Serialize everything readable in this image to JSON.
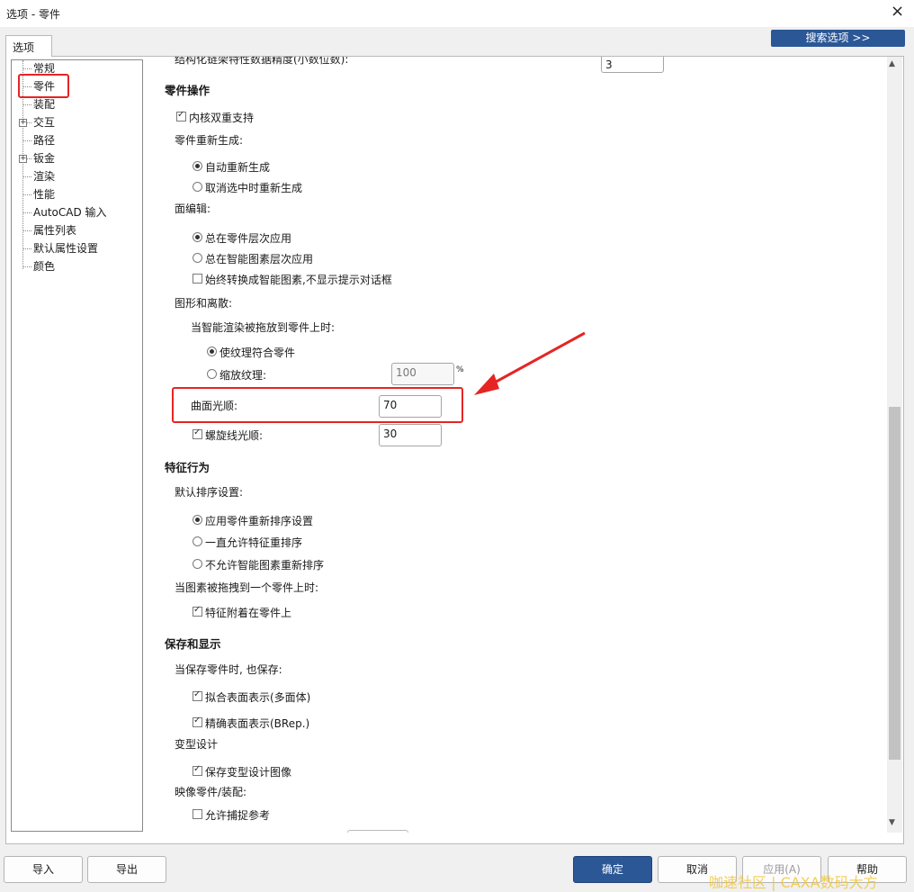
{
  "window": {
    "title": "选项 - 零件",
    "close": "×"
  },
  "tab": {
    "label": "选项"
  },
  "search_button": "搜索选项 >>",
  "tree": [
    {
      "label": "常规",
      "expandable": false
    },
    {
      "label": "零件",
      "expandable": false
    },
    {
      "label": "装配",
      "expandable": false
    },
    {
      "label": "交互",
      "expandable": true
    },
    {
      "label": "路径",
      "expandable": false
    },
    {
      "label": "钣金",
      "expandable": true
    },
    {
      "label": "渲染",
      "expandable": false
    },
    {
      "label": "性能",
      "expandable": false
    },
    {
      "label": "AutoCAD 输入",
      "expandable": false
    },
    {
      "label": "属性列表",
      "expandable": false
    },
    {
      "label": "默认属性设置",
      "expandable": false
    },
    {
      "label": "颜色",
      "expandable": false
    }
  ],
  "content": {
    "top_partial_label": "结构化链架特性数据精度(小数位数):",
    "top_partial_value": "3",
    "part_ops": {
      "heading": "零件操作",
      "dual_kernel": "内核双重支持",
      "regen_label": "零件重新生成:",
      "regen_auto": "自动重新生成",
      "regen_deselect": "取消选中时重新生成",
      "face_edit_label": "面编辑:",
      "face_part_level": "总在零件层次应用",
      "face_smart_level": "总在智能图素层次应用",
      "face_convert": "始终转换成智能图素,不显示提示对话框",
      "graphics_label": "图形和离散:",
      "drag_label": "当智能渲染被拖放到零件上时:",
      "texture_fit": "使纹理符合零件",
      "texture_scale": "缩放纹理:",
      "texture_scale_value": "100",
      "percent": "%",
      "surface_smooth": "曲面光顺:",
      "surface_smooth_value": "70",
      "helix_smooth": "螺旋线光顺:",
      "helix_smooth_value": "30"
    },
    "feature": {
      "heading": "特征行为",
      "sort_label": "默认排序设置:",
      "sort_apply": "应用零件重新排序设置",
      "sort_always": "一直允许特征重排序",
      "sort_never": "不允许智能图素重新排序",
      "drag_label": "当图素被拖拽到一个零件上时:",
      "attach": "特征附着在零件上"
    },
    "save": {
      "heading": "保存和显示",
      "also_save_label": "当保存零件时, 也保存:",
      "approx": "拟合表面表示(多面体)",
      "precise": "精确表面表示(BRep.)",
      "variant_label": "变型设计",
      "variant_image": "保存变型设计图像",
      "mirror_label": "映像零件/装配:",
      "allow_snap": "允许捕捉参考"
    }
  },
  "footer": {
    "import": "导入",
    "export": "导出",
    "ok": "确定",
    "cancel": "取消",
    "apply": "应用(A)",
    "help": "帮助"
  },
  "watermark": "咖速社区 | CAXA数码大方",
  "colors": {
    "accent": "#2b5797",
    "highlight": "#e52524"
  }
}
